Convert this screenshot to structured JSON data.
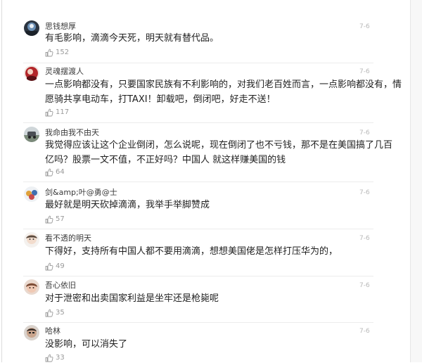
{
  "comments": [
    {
      "username": "思钱想厚",
      "time": "7-6",
      "lines": [
        "有毛影响，滴滴今天死，明天就有替代品。"
      ],
      "likes": "152"
    },
    {
      "username": "灵魂摆渡人",
      "time": "7-6",
      "lines": [
        "一点影响都没有，只要国家民族有不利影响的，对我们老百姓而言，一点影响都没有，情",
        "愿骑共享电动车，打TAXI！卸载吧，倒闭吧，好走不送！"
      ],
      "likes": "117"
    },
    {
      "username": "我命由我不由天",
      "time": "7-6",
      "lines": [
        "我觉得应该让这个企业倒闭，怎么说呢，现在倒闭了也不亏钱，那不是在美国搞了几百",
        "亿吗？股票一文不值，不正好吗？中国人 就这样赚美国的钱"
      ],
      "likes": "64"
    },
    {
      "username": "剑&amp;叶@勇@士",
      "time": "7-6",
      "lines": [
        "最好就是明天砍掉滴滴，我举手举脚赞成"
      ],
      "likes": "57"
    },
    {
      "username": "看不透的明天",
      "time": "7-6",
      "lines": [
        "下得好，支持所有中国人都不要用滴滴，想想美国佬是怎样打压华为的，"
      ],
      "likes": "49"
    },
    {
      "username": "吾心依旧",
      "time": "7-6",
      "lines": [
        "对于泄密和出卖国家利益是坐牢还是枪毙呢"
      ],
      "likes": "35"
    },
    {
      "username": "哈林",
      "time": "7-6",
      "lines": [
        "没影响，可以消失了"
      ],
      "likes": "33"
    }
  ],
  "icons": {
    "like": "thumbs-up-icon"
  },
  "colors": {
    "username": "#3a3a3a",
    "content": "#1f1f1f",
    "meta": "#9a9a9a",
    "time": "#b8b8b8",
    "divider": "#ececec"
  }
}
